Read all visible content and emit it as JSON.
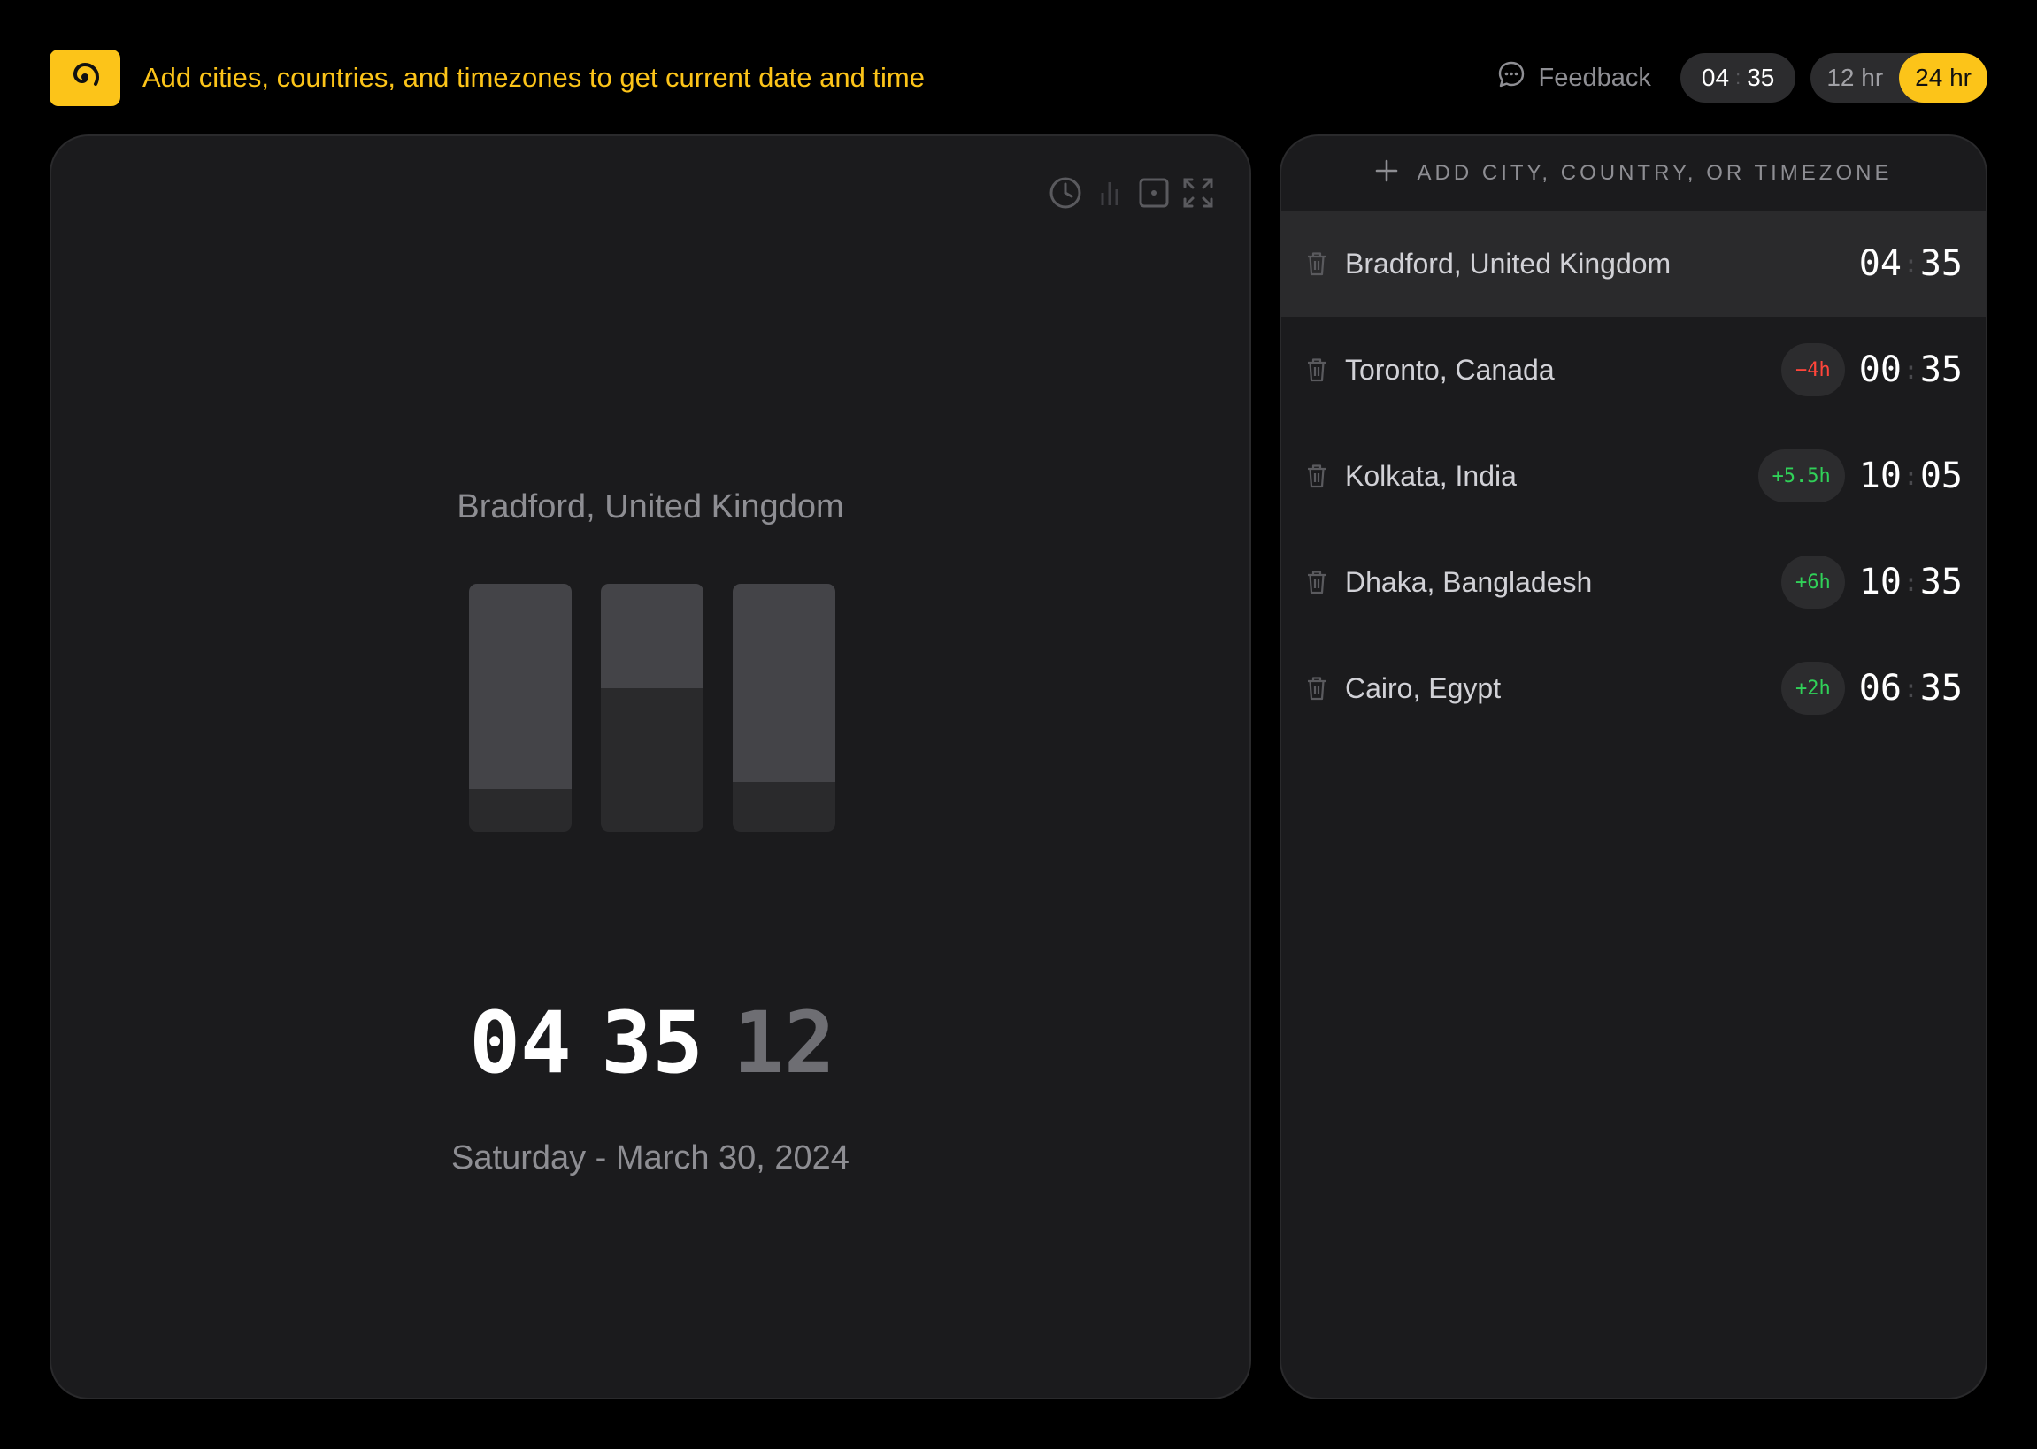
{
  "header": {
    "logo_icon": "spiral-logo-icon",
    "tagline": "Add cities, countries, and timezones to get current date and time",
    "feedback_label": "Feedback",
    "clock": {
      "hours": "04",
      "minutes": "35"
    },
    "format_12": "12 hr",
    "format_24": "24 hr",
    "active_format": "24 hr",
    "accent_color": "#fcc419"
  },
  "main": {
    "city": "Bradford, United Kingdom",
    "hours": "04",
    "minutes": "35",
    "seconds": "12",
    "date": "Saturday - March 30, 2024",
    "tools": [
      "clock-icon",
      "bar-chart-icon",
      "dice-icon",
      "fullscreen-icon"
    ],
    "progress": {
      "hours_fraction": 0.17,
      "minutes_fraction": 0.58,
      "seconds_fraction": 0.2
    }
  },
  "sidebar": {
    "add_label": "ADD CITY, COUNTRY, OR TIMEZONE",
    "cities": [
      {
        "name": "Bradford, United Kingdom",
        "offset": "",
        "hours": "04",
        "minutes": "35",
        "selected": true
      },
      {
        "name": "Toronto, Canada",
        "offset": "−4h",
        "hours": "00",
        "minutes": "35",
        "selected": false
      },
      {
        "name": "Kolkata, India",
        "offset": "+5.5h",
        "hours": "10",
        "minutes": "05",
        "selected": false
      },
      {
        "name": "Dhaka, Bangladesh",
        "offset": "+6h",
        "hours": "10",
        "minutes": "35",
        "selected": false
      },
      {
        "name": "Cairo, Egypt",
        "offset": "+2h",
        "hours": "06",
        "minutes": "35",
        "selected": false
      }
    ]
  }
}
